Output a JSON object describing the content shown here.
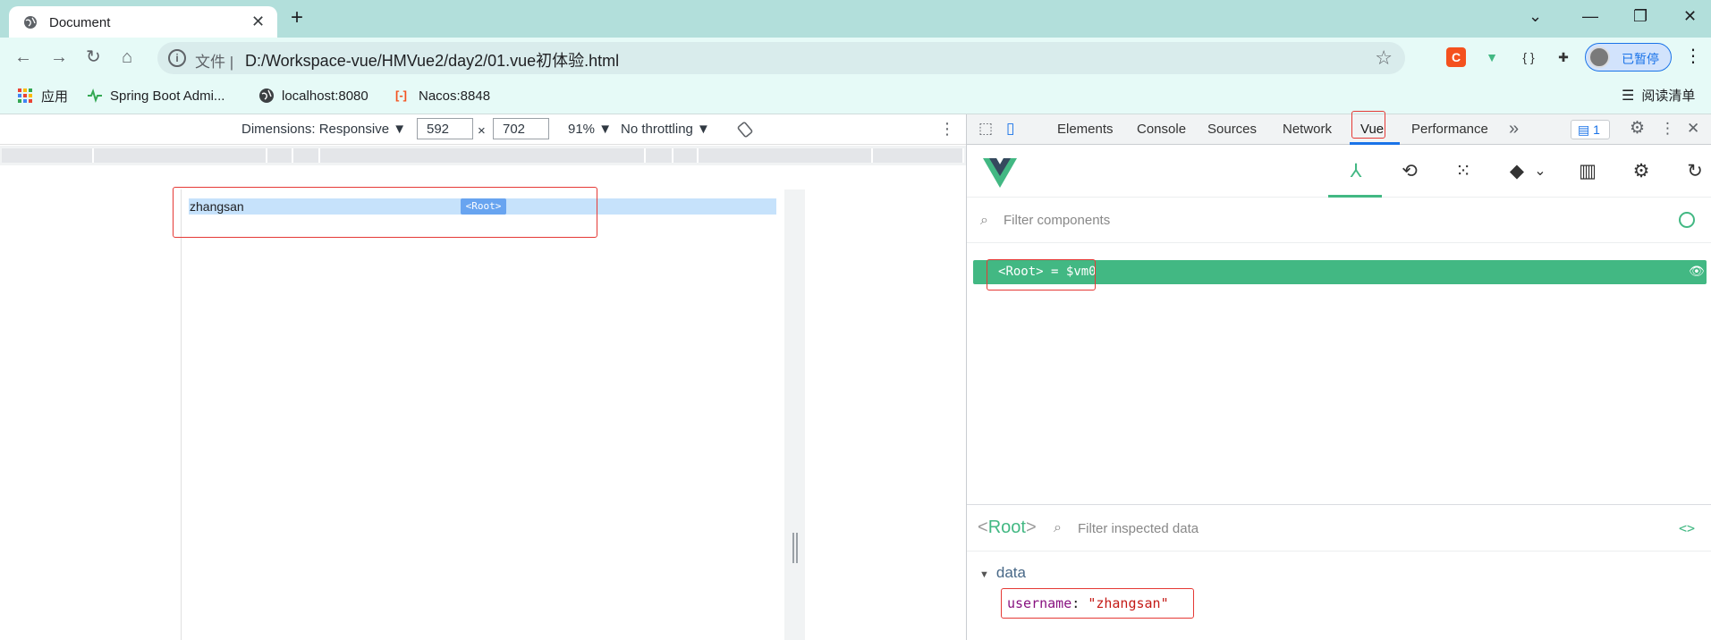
{
  "browser": {
    "tab": {
      "title": "Document",
      "favicon": "globe-icon"
    },
    "address": {
      "scheme_label": "文件",
      "separator": "|",
      "url": "D:/Workspace-vue/HMVue2/day2/01.vue初体验.html"
    },
    "profile": {
      "label": "已暂停"
    },
    "extensions": [
      "c-extension-icon",
      "vue-devtools-icon",
      "json-viewer-icon",
      "puzzle-icon"
    ],
    "bookmarks": [
      {
        "label": "应用",
        "icon": "apps-icon"
      },
      {
        "label": "Spring Boot Admi...",
        "icon": "pulse-icon"
      },
      {
        "label": "localhost:8080",
        "icon": "globe-icon"
      },
      {
        "label": "Nacos:8848",
        "icon": "nacos-icon"
      }
    ],
    "reading_list": "阅读清单"
  },
  "device_toolbar": {
    "dimensions_label": "Dimensions: Responsive ▼",
    "width": "592",
    "height": "702",
    "times": "×",
    "zoom": "91% ▼",
    "throttling": "No throttling ▼"
  },
  "viewport": {
    "highlight_text": "zhangsan",
    "root_chip": "<Root>"
  },
  "devtools": {
    "tabs": [
      "Elements",
      "Console",
      "Sources",
      "Network",
      "Vue",
      "Performance"
    ],
    "active_tab": "Vue",
    "issues_count": "1",
    "more": "»"
  },
  "vue": {
    "filter_placeholder": "Filter components",
    "tree_root_open": "<",
    "tree_root_name": "Root",
    "tree_root_close": ">",
    "tree_root_suffix": "= $vm0",
    "inspector": {
      "component_open": "<",
      "component_name": "Root",
      "component_close": ">",
      "filter_placeholder": "Filter inspected data",
      "code_toggle": "<>",
      "section": "data",
      "caret": "▼",
      "key": "username",
      "colon": ":",
      "value": "\"zhangsan\""
    }
  },
  "colors": {
    "tabstrip": "#b2dfdb",
    "toolbar": "#e6faf7",
    "vue_green": "#42b883",
    "highlight": "#c6e2fb",
    "annotation_red": "#e53935"
  }
}
